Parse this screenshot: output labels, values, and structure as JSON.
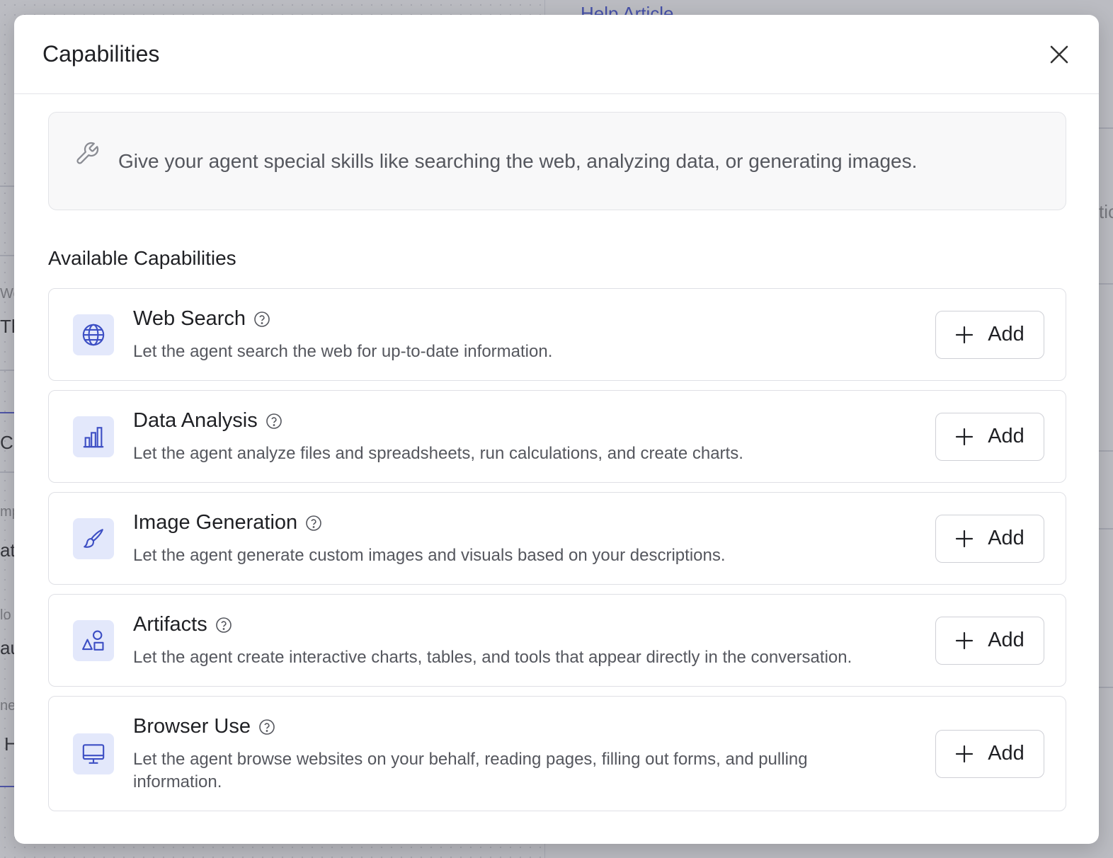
{
  "background": {
    "help_link": "Help Article",
    "fragments": [
      "Wo",
      "Thi",
      "C",
      "mp",
      "at",
      "lo",
      "au",
      "ne",
      "H",
      "tic"
    ]
  },
  "modal": {
    "title": "Capabilities",
    "info_text": "Give your agent special skills like searching the web, analyzing data, or generating images.",
    "section_title": "Available Capabilities",
    "capabilities": [
      {
        "name": "Web Search",
        "description": "Let the agent search the web for up-to-date information.",
        "icon": "globe-icon",
        "button": "Add"
      },
      {
        "name": "Data Analysis",
        "description": "Let the agent analyze files and spreadsheets, run calculations, and create charts.",
        "icon": "bar-chart-icon",
        "button": "Add"
      },
      {
        "name": "Image Generation",
        "description": "Let the agent generate custom images and visuals based on your descriptions.",
        "icon": "paintbrush-icon",
        "button": "Add"
      },
      {
        "name": "Artifacts",
        "description": "Let the agent create interactive charts, tables, and tools that appear directly in the conversation.",
        "icon": "shapes-icon",
        "button": "Add"
      },
      {
        "name": "Browser Use",
        "description": "Let the agent browse websites on your behalf, reading pages, filling out forms, and pulling information.",
        "icon": "monitor-icon",
        "button": "Add"
      }
    ]
  },
  "colors": {
    "accent": "#4a5ad6",
    "icon_bg": "#e3e8fb",
    "overlay": "#3c3e50"
  }
}
